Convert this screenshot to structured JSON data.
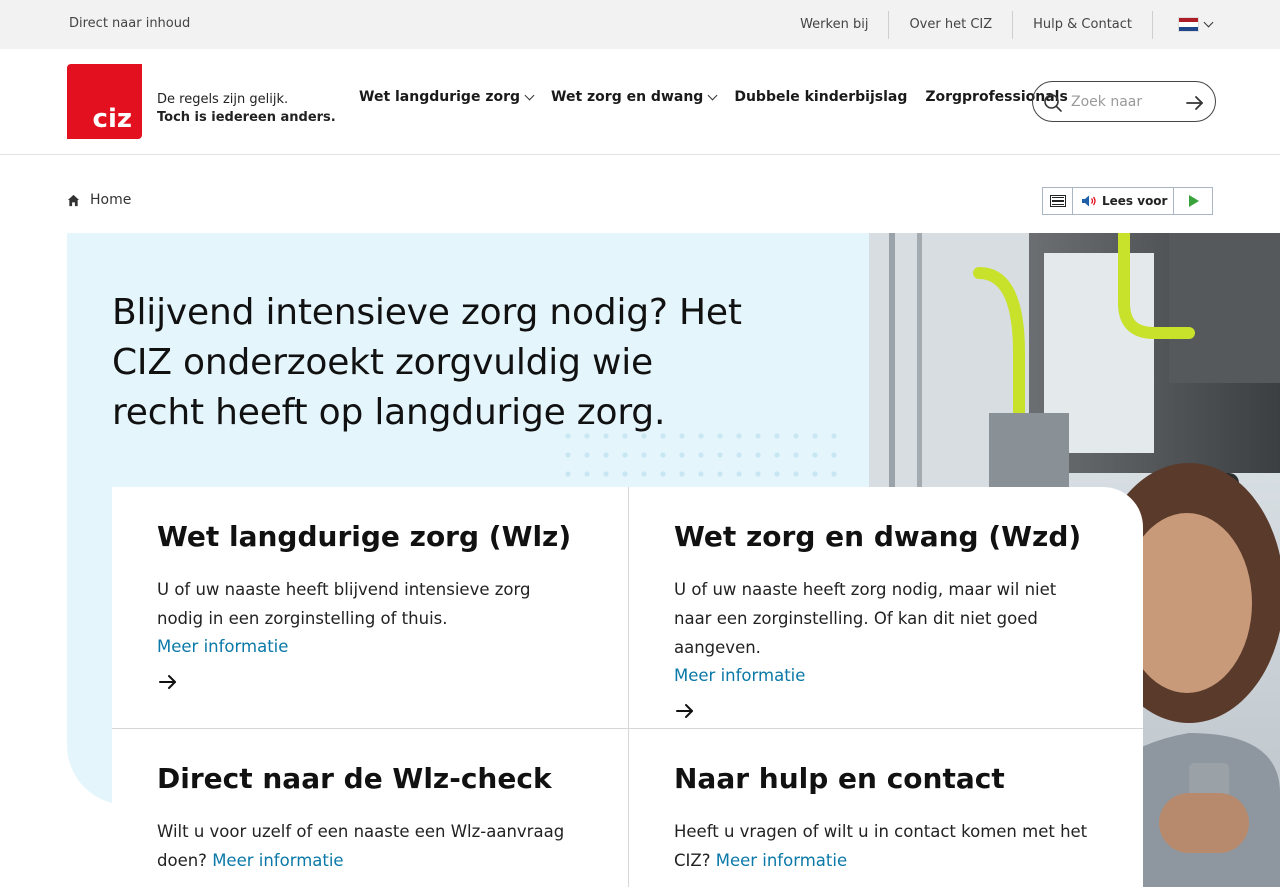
{
  "topbar": {
    "skip_link": "Direct naar inhoud",
    "links": [
      "Werken bij",
      "Over het CIZ",
      "Hulp & Contact"
    ],
    "language_flag_colors": [
      "#ae1c28",
      "#ffffff",
      "#21468b"
    ]
  },
  "header": {
    "logo_text": "ciz",
    "tagline_line1": "De regels zijn gelijk.",
    "tagline_line2": "Toch is iedereen anders.",
    "nav": [
      {
        "label": "Wet langdurige zorg",
        "has_dropdown": true
      },
      {
        "label": "Wet zorg en dwang",
        "has_dropdown": true
      },
      {
        "label": "Dubbele kinderbijslag",
        "has_dropdown": false
      },
      {
        "label": "Zorgprofessionals",
        "has_dropdown": false
      }
    ],
    "search_placeholder": "Zoek naar"
  },
  "breadcrumb": {
    "home": "Home"
  },
  "readspeaker": {
    "label": "Lees voor"
  },
  "hero": {
    "title": "Blijvend intensieve zorg nodig? Het CIZ onderzoekt zorgvuldig wie recht heeft op langdurige zorg."
  },
  "cards": [
    {
      "title": "Wet langdurige zorg (Wlz)",
      "text": "U of uw naaste heeft blijvend intensieve zorg nodig in een zorginstelling of thuis.",
      "link": "Meer informatie"
    },
    {
      "title": "Wet zorg en dwang (Wzd)",
      "text": "U of uw naaste heeft zorg nodig, maar wil niet naar een zorginstelling. Of kan dit niet goed aangeven.",
      "link": "Meer informatie"
    },
    {
      "title": "Direct naar de Wlz-check",
      "text": "Wilt u voor uzelf of een naaste een Wlz-aanvraag doen?",
      "link": "Meer informatie"
    },
    {
      "title": "Naar hulp en contact",
      "text": "Heeft u vragen of wilt u in contact komen met het CIZ?",
      "link": "Meer informatie"
    }
  ],
  "colors": {
    "brand_red": "#e3101f",
    "hero_bg": "#e4f5fc",
    "link_blue": "#0a78a8",
    "dots": "#c9e6f3"
  }
}
